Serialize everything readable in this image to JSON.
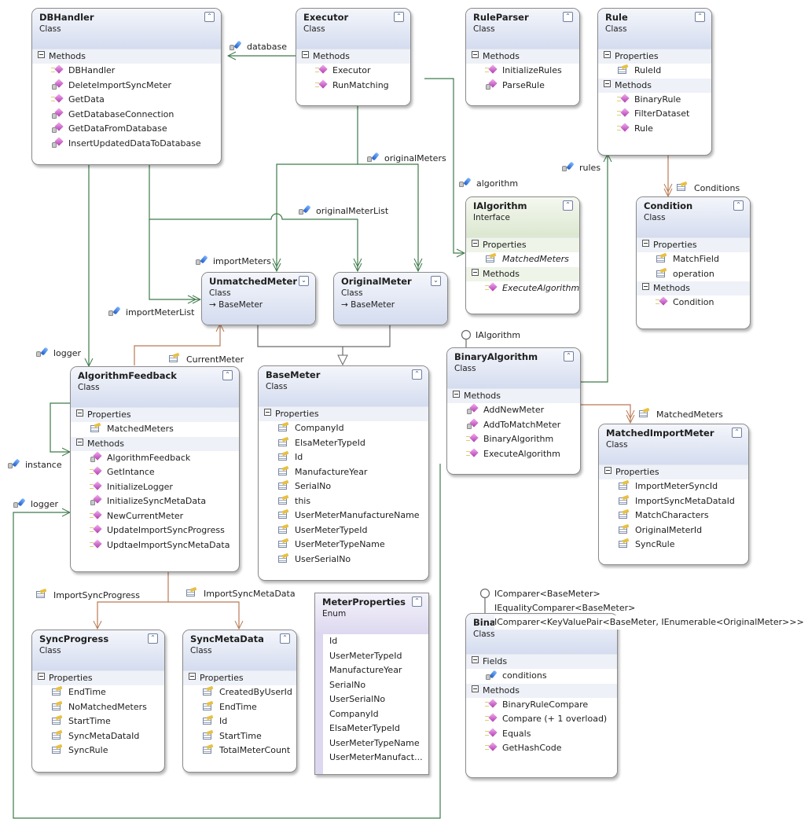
{
  "diagram": {
    "classes": {
      "dbhandler": {
        "name": "DBHandler",
        "kind": "Class",
        "sections": [
          {
            "title": "Methods",
            "items": [
              {
                "label": "DBHandler",
                "icon": "public-method"
              },
              {
                "label": "DeleteImportSyncMeter",
                "icon": "private-method"
              },
              {
                "label": "GetData",
                "icon": "public-method"
              },
              {
                "label": "GetDatabaseConnection",
                "icon": "private-method"
              },
              {
                "label": "GetDataFromDatabase",
                "icon": "private-method"
              },
              {
                "label": "InsertUpdatedDataToDatabase",
                "icon": "private-method"
              }
            ]
          }
        ]
      },
      "executor": {
        "name": "Executor",
        "kind": "Class",
        "sections": [
          {
            "title": "Methods",
            "items": [
              {
                "label": "Executor",
                "icon": "public-method"
              },
              {
                "label": "RunMatching",
                "icon": "public-method"
              }
            ]
          }
        ]
      },
      "ruleparser": {
        "name": "RuleParser",
        "kind": "Class",
        "sections": [
          {
            "title": "Methods",
            "items": [
              {
                "label": "InitializeRules",
                "icon": "public-method"
              },
              {
                "label": "ParseRule",
                "icon": "private-method"
              }
            ]
          }
        ]
      },
      "rule": {
        "name": "Rule",
        "kind": "Class",
        "sections": [
          {
            "title": "Properties",
            "items": [
              {
                "label": "RuleId",
                "icon": "property"
              }
            ]
          },
          {
            "title": "Methods",
            "items": [
              {
                "label": "BinaryRule",
                "icon": "public-method"
              },
              {
                "label": "FilterDataset",
                "icon": "public-method"
              },
              {
                "label": "Rule",
                "icon": "public-method"
              }
            ]
          }
        ]
      },
      "ialgorithm": {
        "name": "IAlgorithm",
        "kind": "Interface",
        "sections": [
          {
            "title": "Properties",
            "items": [
              {
                "label": "MatchedMeters",
                "icon": "property"
              }
            ]
          },
          {
            "title": "Methods",
            "items": [
              {
                "label": "ExecuteAlgorithm",
                "icon": "public-method"
              }
            ]
          }
        ]
      },
      "condition": {
        "name": "Condition",
        "kind": "Class",
        "sections": [
          {
            "title": "Properties",
            "items": [
              {
                "label": "MatchField",
                "icon": "property"
              },
              {
                "label": "operation",
                "icon": "property"
              }
            ]
          },
          {
            "title": "Methods",
            "items": [
              {
                "label": "Condition",
                "icon": "public-method"
              }
            ]
          }
        ]
      },
      "unmatchedmeter": {
        "name": "UnmatchedMeter",
        "kind": "Class",
        "base": "→ BaseMeter"
      },
      "originalmeter": {
        "name": "OriginalMeter",
        "kind": "Class",
        "base": "→ BaseMeter"
      },
      "algorithmfeedback": {
        "name": "AlgorithmFeedback",
        "kind": "Class",
        "sections": [
          {
            "title": "Properties",
            "items": [
              {
                "label": "MatchedMeters",
                "icon": "property"
              }
            ]
          },
          {
            "title": "Methods",
            "items": [
              {
                "label": "AlgorithmFeedback",
                "icon": "private-method"
              },
              {
                "label": "GetIntance",
                "icon": "public-method"
              },
              {
                "label": "InitializeLogger",
                "icon": "public-method"
              },
              {
                "label": "InitializeSyncMetaData",
                "icon": "private-method"
              },
              {
                "label": "NewCurrentMeter",
                "icon": "public-method"
              },
              {
                "label": "UpdateImportSyncProgress",
                "icon": "public-method"
              },
              {
                "label": "UpdtaeImportSyncMetaData",
                "icon": "public-method"
              }
            ]
          }
        ]
      },
      "basemeter": {
        "name": "BaseMeter",
        "kind": "Class",
        "sections": [
          {
            "title": "Properties",
            "items": [
              {
                "label": "CompanyId",
                "icon": "property"
              },
              {
                "label": "ElsaMeterTypeId",
                "icon": "property"
              },
              {
                "label": "Id",
                "icon": "property"
              },
              {
                "label": "ManufactureYear",
                "icon": "property"
              },
              {
                "label": "SerialNo",
                "icon": "property"
              },
              {
                "label": "this",
                "icon": "property"
              },
              {
                "label": "UserMeterManufactureName",
                "icon": "property"
              },
              {
                "label": "UserMeterTypeId",
                "icon": "property"
              },
              {
                "label": "UserMeterTypeName",
                "icon": "property"
              },
              {
                "label": "UserSerialNo",
                "icon": "property"
              }
            ]
          }
        ]
      },
      "binaryalgorithm": {
        "name": "BinaryAlgorithm",
        "kind": "Class",
        "sections": [
          {
            "title": "Methods",
            "items": [
              {
                "label": "AddNewMeter",
                "icon": "private-method"
              },
              {
                "label": "AddToMatchMeter",
                "icon": "private-method"
              },
              {
                "label": "BinaryAlgorithm",
                "icon": "public-method"
              },
              {
                "label": "ExecuteAlgorithm",
                "icon": "public-method"
              }
            ]
          }
        ]
      },
      "matchedimportmeter": {
        "name": "MatchedImportMeter",
        "kind": "Class",
        "sections": [
          {
            "title": "Properties",
            "items": [
              {
                "label": "ImportMeterSyncId",
                "icon": "property"
              },
              {
                "label": "ImportSyncMetaDataId",
                "icon": "property"
              },
              {
                "label": "MatchCharacters",
                "icon": "property"
              },
              {
                "label": "OriginalMeterId",
                "icon": "property"
              },
              {
                "label": "SyncRule",
                "icon": "property"
              }
            ]
          }
        ]
      },
      "syncprogress": {
        "name": "SyncProgress",
        "kind": "Class",
        "sections": [
          {
            "title": "Properties",
            "items": [
              {
                "label": "EndTime",
                "icon": "property"
              },
              {
                "label": "NoMatchedMeters",
                "icon": "property"
              },
              {
                "label": "StartTime",
                "icon": "property"
              },
              {
                "label": "SyncMetaDataId",
                "icon": "property"
              },
              {
                "label": "SyncRule",
                "icon": "property"
              }
            ]
          }
        ]
      },
      "syncmetadata": {
        "name": "SyncMetaData",
        "kind": "Class",
        "sections": [
          {
            "title": "Properties",
            "items": [
              {
                "label": "CreatedByUserId",
                "icon": "property"
              },
              {
                "label": "EndTime",
                "icon": "property"
              },
              {
                "label": "Id",
                "icon": "property"
              },
              {
                "label": "StartTime",
                "icon": "property"
              },
              {
                "label": "TotalMeterCount",
                "icon": "property"
              }
            ]
          }
        ]
      },
      "binaryrulecompare": {
        "name": "BinaryRuleCompare",
        "kind": "Class",
        "sections": [
          {
            "title": "Fields",
            "items": [
              {
                "label": "conditions",
                "icon": "field"
              }
            ]
          },
          {
            "title": "Methods",
            "items": [
              {
                "label": "BinaryRuleCompare",
                "icon": "public-method"
              },
              {
                "label": "Compare (+ 1 overload)",
                "icon": "public-method"
              },
              {
                "label": "Equals",
                "icon": "public-method"
              },
              {
                "label": "GetHashCode",
                "icon": "public-method"
              }
            ]
          }
        ]
      }
    },
    "enum": {
      "name": "MeterProperties",
      "kind": "Enum",
      "values": [
        "Id",
        "UserMeterTypeId",
        "ManufactureYear",
        "SerialNo",
        "UserSerialNo",
        "CompanyId",
        "ElsaMeterTypeId",
        "UserMeterTypeName",
        "UserMeterManufact..."
      ]
    },
    "association_labels": {
      "database": "database",
      "originalMeters": "originalMeters",
      "algorithm": "algorithm",
      "rules": "rules",
      "conditions": "Conditions",
      "originalMeterList": "originalMeterList",
      "importMeters": "importMeters",
      "importMeterList": "importMeterList",
      "logger_top": "logger",
      "currentMeter": "CurrentMeter",
      "instance": "instance",
      "logger_bottom": "logger",
      "matchedMeters": "MatchedMeters",
      "importSyncProgress": "ImportSyncProgress",
      "importSyncMetaData": "ImportSyncMetaData"
    },
    "interface_lollipops": {
      "binaryalgorithm": [
        "IAlgorithm"
      ],
      "binaryrulecompare": [
        "IComparer<BaseMeter>",
        "IEqualityComparer<BaseMeter>",
        "IComparer<KeyValuePair<BaseMeter,  IEnumerable<OriginalMeter>>>"
      ]
    },
    "colors": {
      "association": "#3e7a4a",
      "property_association": "#b97a55",
      "inheritance": "#6a6a6a",
      "class_header": "#d4dcef",
      "interface_header": "#dbe7cf",
      "enum_header": "#ddd8ef"
    }
  }
}
